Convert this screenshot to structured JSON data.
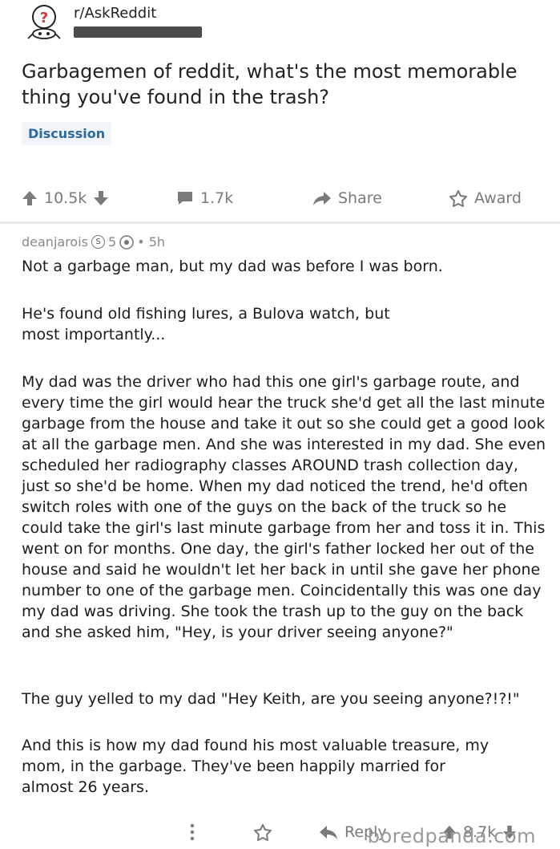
{
  "header": {
    "subreddit": "r/AskReddit",
    "title": "Garbagemen of reddit, what's the most memorable thing you've found in the trash?",
    "flair": "Discussion"
  },
  "actions": {
    "upvotes": "10.5k",
    "comments": "1.7k",
    "share_label": "Share",
    "award_label": "Award"
  },
  "comment": {
    "author": "deanjarois",
    "badge_count": "5",
    "time": "• 5h",
    "paragraphs": [
      "Not a garbage man, but my dad was before I was born.",
      "He's found old fishing lures, a Bulova watch, but most importantly...",
      "My dad was the driver who had this one girl's garbage route, and every time the girl would hear the truck she'd get all the last minute garbage from the house and take it out so she could get a good look at all the garbage men. And she was interested in my dad. She even scheduled her radiography classes AROUND trash collection day, just so she'd be home. When my dad noticed the trend, he'd often switch roles with one of the guys on the back of the truck so he could take the girl's last minute garbage from her and toss it in. This went on for months. One day, the girl's father locked her out of the house and said he wouldn't let her back in until she gave her phone number to one of the garbage men. Coincidentally this was one day my dad was driving. She took the trash up to the guy on the back and she asked him, \"Hey, is your driver seeing anyone?\"",
      "The guy yelled to my dad \"Hey Keith, are you seeing anyone?!?!\"",
      "And this is how my dad found his most valuable treasure, my mom, in the garbage. They've been happily married for almost 26 years."
    ],
    "reply_label": "Reply",
    "score": "8.7k"
  },
  "watermark": "boredpanda.com",
  "colors": {
    "flair_bg": "#f1f4f8",
    "flair_text": "#2d6a9f",
    "muted": "#7a7a7a"
  }
}
